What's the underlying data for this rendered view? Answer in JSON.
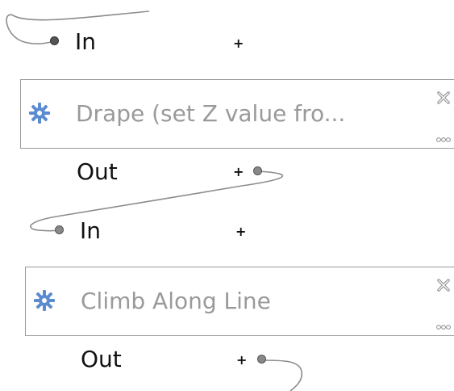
{
  "ports": {
    "in_label": "In",
    "out_label": "Out",
    "add_symbol": "+"
  },
  "algorithms": [
    {
      "title": "Drape (set Z value fro...",
      "icon": "gear-icon"
    },
    {
      "title": "Climb Along Line",
      "icon": "gear-icon"
    }
  ],
  "colors": {
    "box_border": "#9a9a9a",
    "title_text": "#9a9a9a",
    "gear": "#5b8bd0",
    "wire": "#8c8c8c",
    "port_dot": "#888888"
  }
}
